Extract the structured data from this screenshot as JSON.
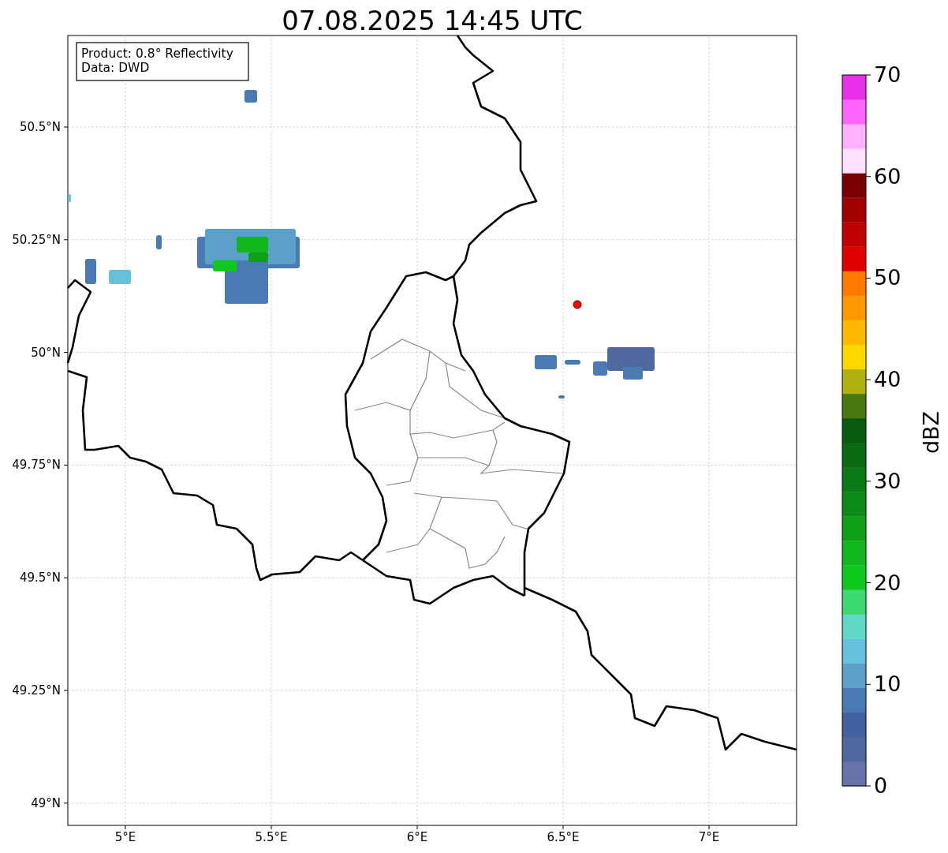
{
  "title": "07.08.2025 14:45 UTC",
  "map": {
    "info_box": [
      "Product: 0.8° Reflectivity",
      "Data: DWD"
    ],
    "yticks": [
      "50.5°N",
      "50.25°N",
      "50°N",
      "49.75°N",
      "49.5°N",
      "49.25°N",
      "49°N"
    ],
    "xticks": [
      "5°E",
      "5.5°E",
      "6°E",
      "6.5°E",
      "7°E"
    ]
  },
  "colorbar": {
    "label": "dBZ",
    "ticks": [
      "70",
      "60",
      "50",
      "40",
      "30",
      "20",
      "10",
      "0"
    ],
    "bands": [
      {
        "color": "#6474a8"
      },
      {
        "color": "#5068a0"
      },
      {
        "color": "#4060a0"
      },
      {
        "color": "#4a7ab4"
      },
      {
        "color": "#5aa0c8"
      },
      {
        "color": "#64c0dc"
      },
      {
        "color": "#60d8c8"
      },
      {
        "color": "#3cd870"
      },
      {
        "color": "#10c81c"
      },
      {
        "color": "#10b81c"
      },
      {
        "color": "#10a018"
      },
      {
        "color": "#0c8a18"
      },
      {
        "color": "#0a7a14"
      },
      {
        "color": "#0a6a14"
      },
      {
        "color": "#085a10"
      },
      {
        "color": "#4a7810"
      },
      {
        "color": "#b0b010"
      },
      {
        "color": "#ffd800"
      },
      {
        "color": "#ffb800"
      },
      {
        "color": "#ff9800"
      },
      {
        "color": "#ff7800"
      },
      {
        "color": "#e00000"
      },
      {
        "color": "#c00000"
      },
      {
        "color": "#a00000"
      },
      {
        "color": "#780000"
      },
      {
        "color": "#ffe0ff"
      },
      {
        "color": "#ffb0ff"
      },
      {
        "color": "#ff64ff"
      },
      {
        "color": "#e830e8"
      }
    ]
  }
}
